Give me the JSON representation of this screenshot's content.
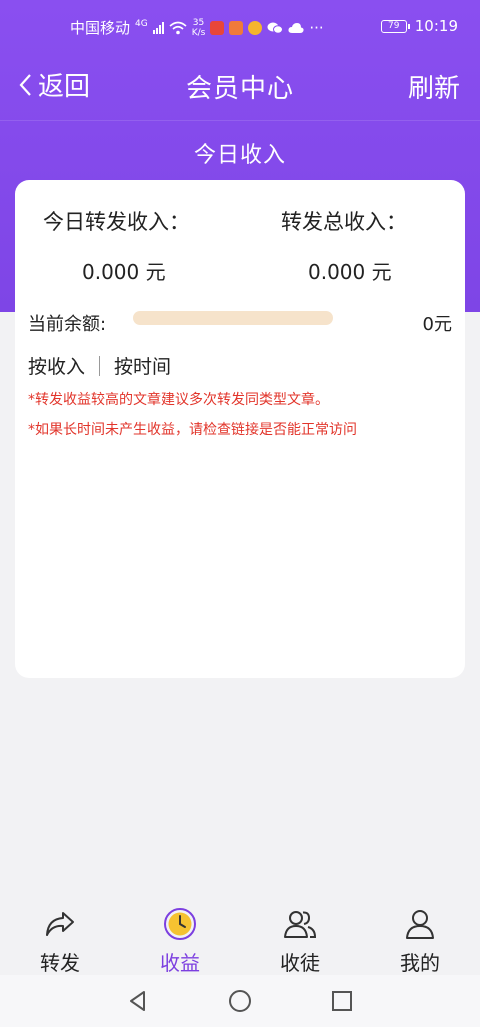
{
  "status_bar": {
    "carrier": "中国移动",
    "network_type": "4G",
    "speed_value": "35",
    "speed_unit": "K/s",
    "battery": "79",
    "time": "10:19"
  },
  "header": {
    "back_label": "返回",
    "title": "会员中心",
    "refresh_label": "刷新"
  },
  "section_title": "今日收入",
  "stats": {
    "today_label": "今日转发收入：",
    "today_value": "0.000 元",
    "total_label": "转发总收入：",
    "total_value": "0.000 元"
  },
  "balance": {
    "label": "当前余额:",
    "value": "0元",
    "progress": 0
  },
  "tabs": {
    "by_income": "按收入",
    "by_time": "按时间"
  },
  "notes": {
    "note1": "*转发收益较高的文章建议多次转发同类型文章。",
    "note2": "*如果长时间未产生收益，请检查链接是否能正常访问"
  },
  "bottom_nav": [
    {
      "label": "转发",
      "icon": "share-icon",
      "active": false
    },
    {
      "label": "收益",
      "icon": "clock-icon",
      "active": true
    },
    {
      "label": "收徒",
      "icon": "users-icon",
      "active": false
    },
    {
      "label": "我的",
      "icon": "user-icon",
      "active": false
    }
  ],
  "colors": {
    "primary": "#7e45e6",
    "accent_active": "#7c3fe0",
    "warning_text": "#e2352b",
    "progress_track": "#f6e3cb"
  }
}
